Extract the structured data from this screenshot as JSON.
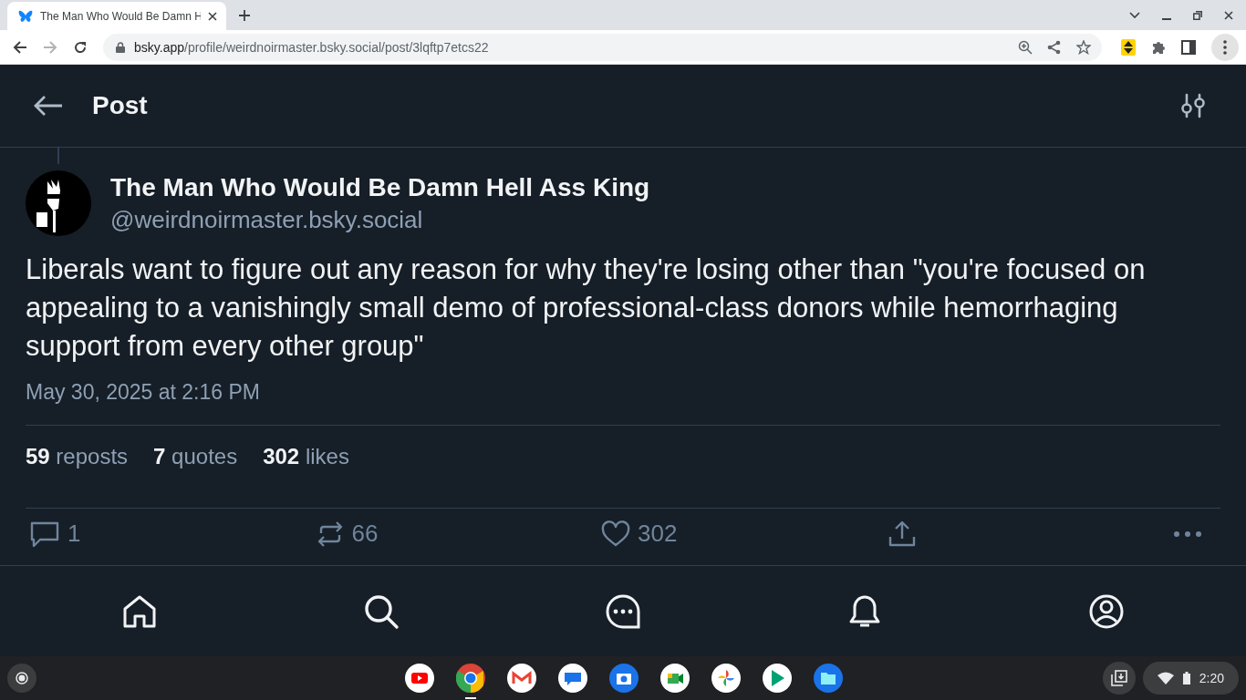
{
  "browser": {
    "tab": {
      "title": "The Man Who Would Be Damn H",
      "selected": true
    },
    "url": {
      "host": "bsky.app",
      "path": "/profile/weirdnoirmaster.bsky.social/post/3lqftp7etcs22"
    }
  },
  "header": {
    "title": "Post"
  },
  "post": {
    "author": "The Man Who Would Be Damn Hell Ass King",
    "handle": "@weirdnoirmaster.bsky.social",
    "text": "Liberals want to figure out any reason for why they're losing other than \"you're focused on appealing to a vanishingly small demo of professional-class donors while hemorrhaging support from every other group\"",
    "date": "May 30, 2025 at 2:16 PM",
    "stats": [
      {
        "count": "59",
        "label": "reposts"
      },
      {
        "count": "7",
        "label": "quotes"
      },
      {
        "count": "302",
        "label": "likes"
      }
    ],
    "actions": [
      {
        "kind": "reply",
        "count": "1"
      },
      {
        "kind": "repost",
        "count": "66"
      },
      {
        "kind": "like",
        "count": "302"
      },
      {
        "kind": "share"
      },
      {
        "kind": "more"
      }
    ]
  },
  "bottom_nav": [
    {
      "kind": "home"
    },
    {
      "kind": "search"
    },
    {
      "kind": "chat"
    },
    {
      "kind": "notifications"
    },
    {
      "kind": "profile"
    }
  ],
  "shelf": {
    "apps": [
      {
        "kind": "youtube",
        "active": false
      },
      {
        "kind": "chrome",
        "active": true
      },
      {
        "kind": "gmail",
        "active": false
      },
      {
        "kind": "messages",
        "active": false
      },
      {
        "kind": "camera",
        "active": false
      },
      {
        "kind": "meet",
        "active": false
      },
      {
        "kind": "photos",
        "active": false
      },
      {
        "kind": "play",
        "active": false
      },
      {
        "kind": "files",
        "active": false
      }
    ],
    "time": "2:20"
  }
}
